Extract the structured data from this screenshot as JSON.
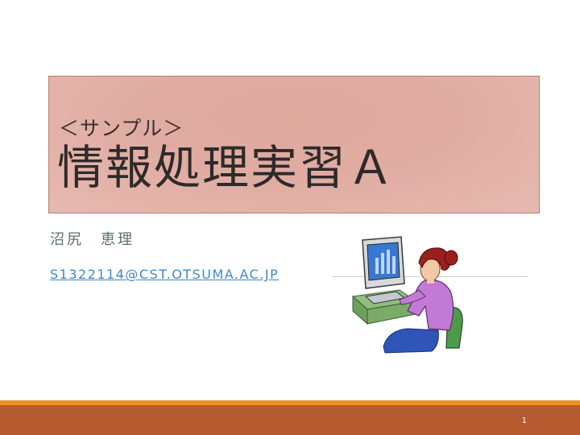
{
  "slide": {
    "subtitle": "＜サンプル＞",
    "title": "情報処理実習Ａ",
    "author": "沼尻　恵理",
    "email": "S1322114@CST.OTSUMA.AC.JP",
    "slide_number": "1"
  },
  "colors": {
    "title_box_fill": "#e0aca2",
    "title_box_border": "#b8826f",
    "email_link": "#3f87c6",
    "footer_bar": "#b65a2f",
    "footer_stripe": "#e8911f"
  },
  "icons": {
    "clipart": "woman-at-computer-clipart"
  }
}
